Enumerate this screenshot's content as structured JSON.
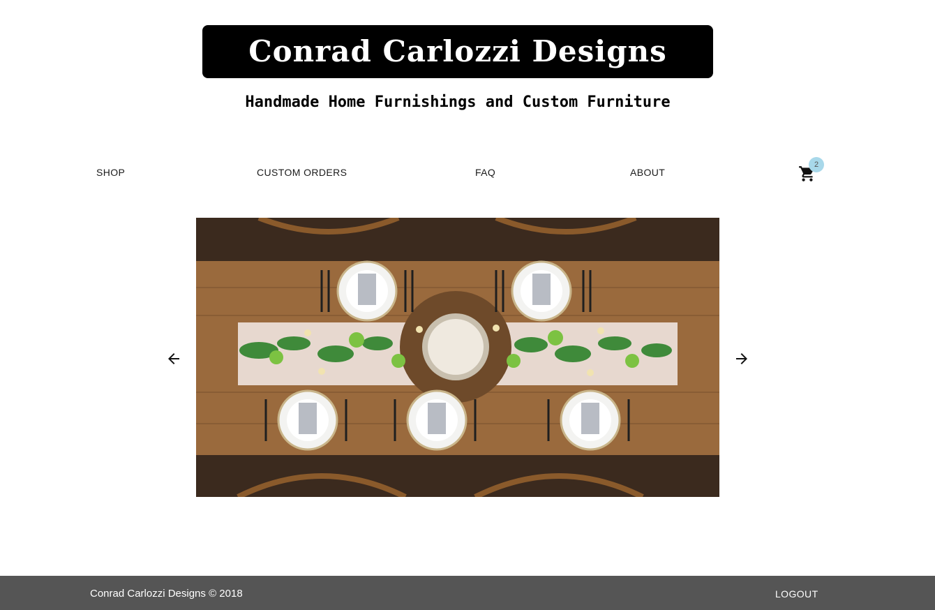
{
  "brand": {
    "title": "Conrad Carlozzi Designs",
    "tagline": "Handmade Home Furnishings and Custom Furniture"
  },
  "nav": {
    "items": [
      {
        "label": "SHOP"
      },
      {
        "label": "CUSTOM ORDERS"
      },
      {
        "label": "FAQ"
      },
      {
        "label": "ABOUT"
      }
    ],
    "cart_count": "2",
    "cart_icon": "shopping-cart-icon"
  },
  "carousel": {
    "prev_icon": "arrow-left-icon",
    "next_icon": "arrow-right-icon",
    "image": "dining-table-place-settings"
  },
  "footer": {
    "copyright": "Conrad Carlozzi Designs © 2018",
    "logout_label": "LOGOUT",
    "background": "#555555"
  },
  "colors": {
    "brand_bg": "#000000",
    "badge": "#a8d8ea"
  }
}
